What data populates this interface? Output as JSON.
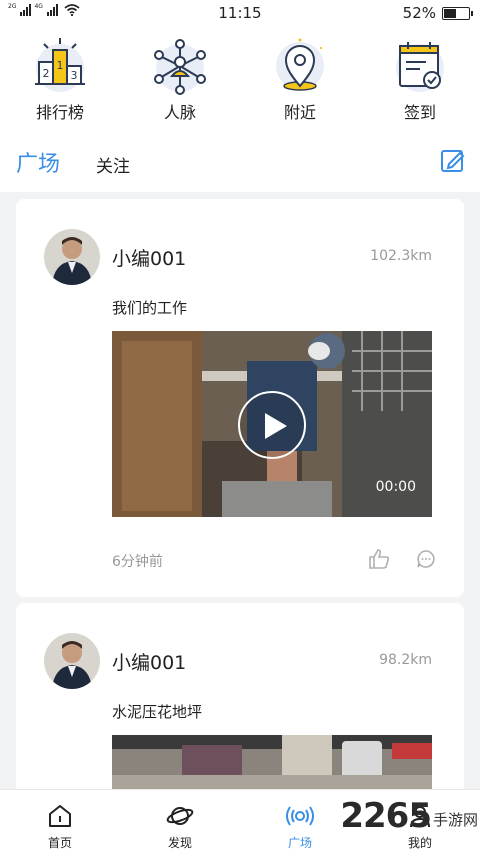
{
  "status_bar": {
    "network": "2G",
    "network2": "4G",
    "time": "11:15",
    "battery_text": "52%",
    "battery_level": 0.52
  },
  "top_nav": [
    {
      "label": "排行榜",
      "icon": "podium-icon"
    },
    {
      "label": "人脉",
      "icon": "network-icon"
    },
    {
      "label": "附近",
      "icon": "location-pin-icon"
    },
    {
      "label": "签到",
      "icon": "calendar-check-icon"
    }
  ],
  "tabs": {
    "square": "广场",
    "follow": "关注"
  },
  "posts": [
    {
      "username": "小编001",
      "distance": "102.3km",
      "description": "我们的工作",
      "duration": "00:00",
      "time_ago": "6分钟前"
    },
    {
      "username": "小编001",
      "distance": "98.2km",
      "description": "水泥压花地坪"
    }
  ],
  "bottom_nav": [
    {
      "label": "首页",
      "icon": "home-icon"
    },
    {
      "label": "发现",
      "icon": "planet-icon"
    },
    {
      "label": "广场",
      "icon": "broadcast-icon",
      "active": true
    },
    {
      "label": "我的",
      "icon": "user-icon"
    }
  ],
  "watermark": {
    "number": "2265",
    "site": "手游网"
  },
  "colors": {
    "accent": "#3a8ee6",
    "secondary_text": "#999999",
    "icon_yellow": "#f5c518"
  }
}
